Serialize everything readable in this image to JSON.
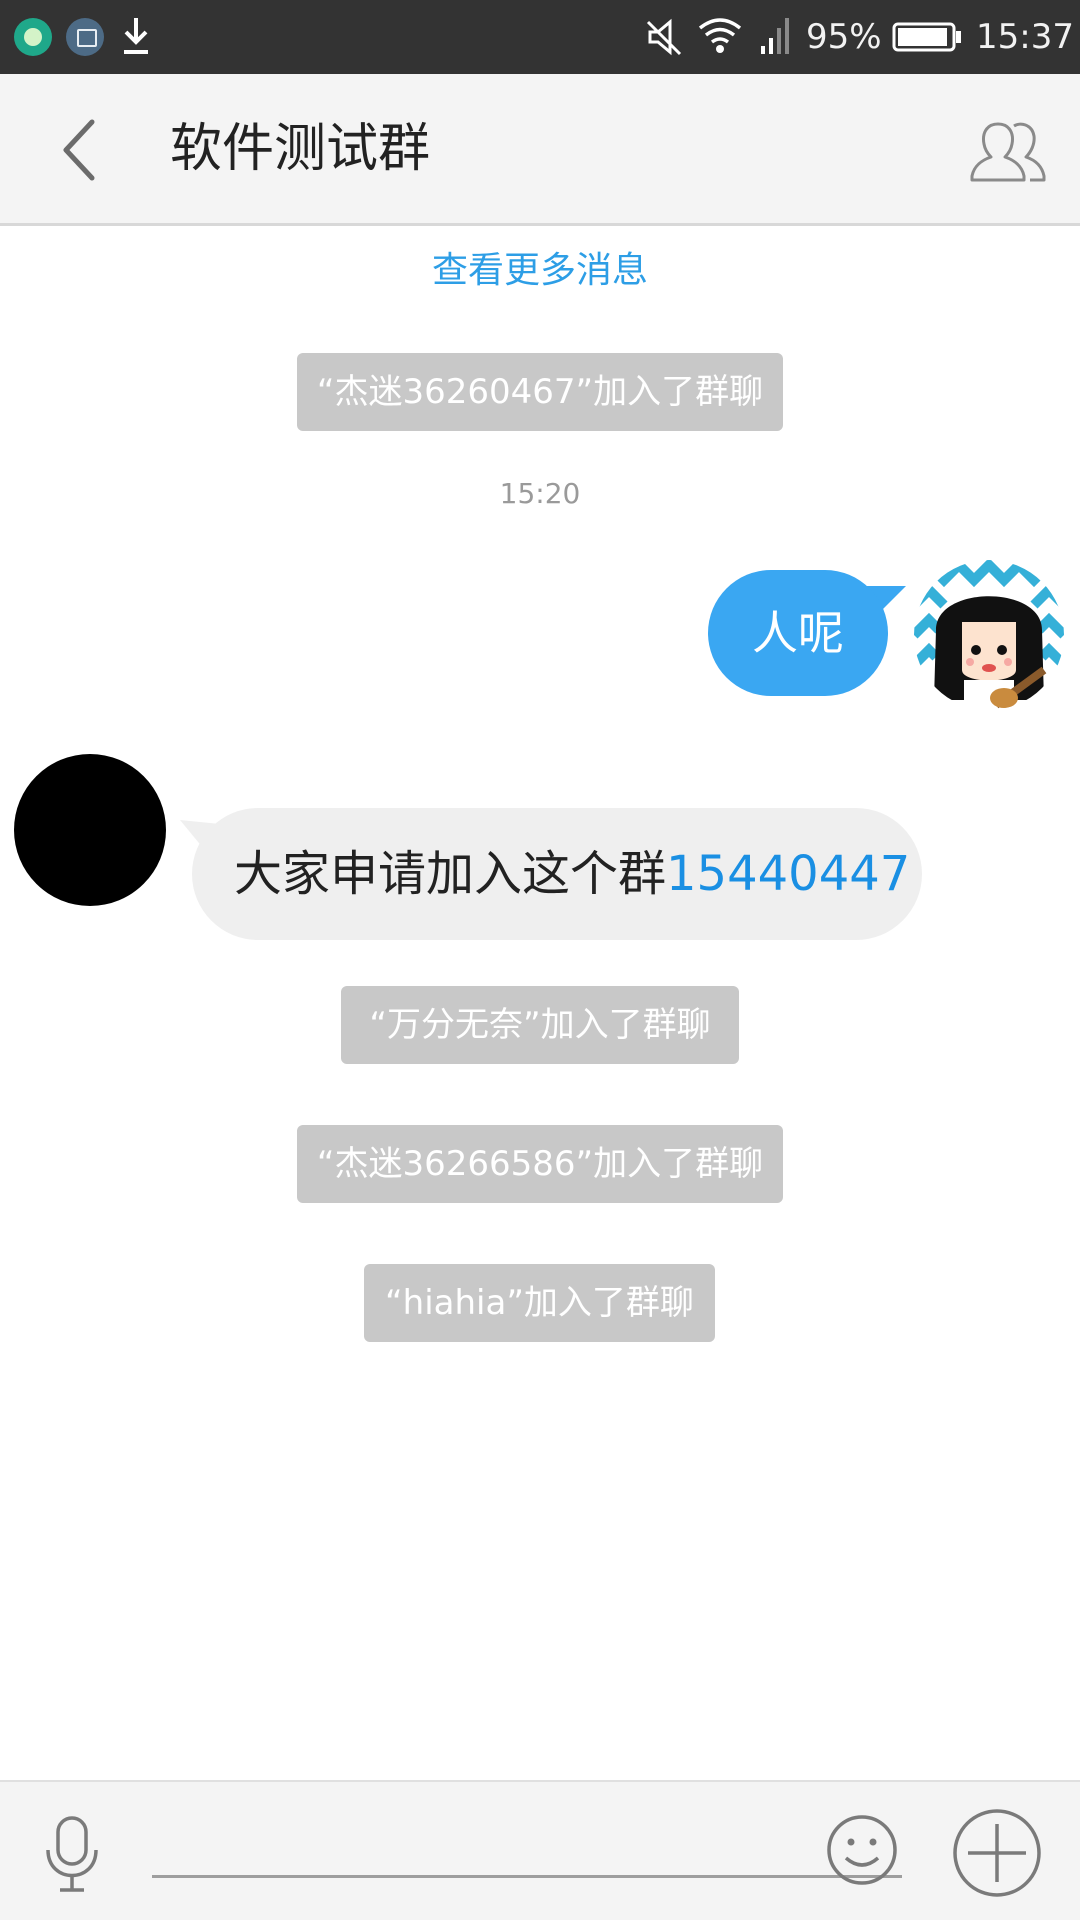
{
  "status_bar": {
    "icons": [
      "app-notification-icon",
      "screenshot-icon",
      "download-icon",
      "mute-icon",
      "wifi-icon",
      "signal-icon",
      "battery-icon"
    ],
    "battery": "95%",
    "battery_level": 0.95,
    "time": "15:37"
  },
  "header": {
    "title": "软件测试群",
    "back_icon": "back-chevron-icon",
    "members_icon": "group-members-icon"
  },
  "chat": {
    "load_more": "查看更多消息",
    "system_1": "“杰迷36260467”加入了群聊",
    "timestamp": "15:20",
    "self_message": "人呢",
    "other_message_text": "大家申请加入这个群",
    "other_message_link": "15440447",
    "system_2": "“万分无奈”加入了群聊",
    "system_3": "“杰迷36266586”加入了群聊",
    "system_4": "“hiahia”加入了群聊"
  },
  "input_bar": {
    "voice_icon": "microphone-icon",
    "input_value": "",
    "emoji_icon": "smiley-icon",
    "more_icon": "plus-circle-icon"
  },
  "colors": {
    "status_bar_bg": "#333333",
    "accent_blue": "#3aa7f2",
    "link_blue": "#1a8fe3",
    "system_bubble": "#c8c8c8",
    "other_bubble": "#efefef"
  }
}
